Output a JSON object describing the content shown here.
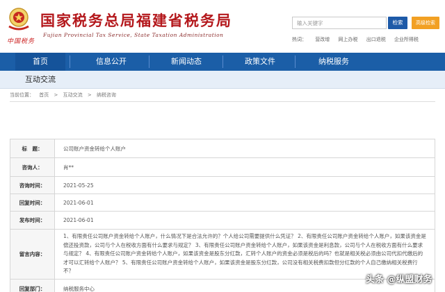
{
  "header": {
    "site_title": "国家税务总局福建省税务局",
    "site_subtitle": "Fujian Provincial Tax Service, State Taxation Administration",
    "logo_text": "中国税务",
    "search_placeholder": "输入关键字",
    "search_button": "检索",
    "advanced_button": "高级检索",
    "hot_searches": [
      "热词：",
      "营改增",
      "网上办税",
      "出口退税",
      "企业所得税"
    ]
  },
  "nav": {
    "items": [
      {
        "label": "首页"
      },
      {
        "label": "信息公开"
      },
      {
        "label": "新闻动态"
      },
      {
        "label": "政策文件"
      },
      {
        "label": "纳税服务"
      }
    ],
    "subnav_label": "互动交流"
  },
  "breadcrumb": [
    "当前位置：",
    "首页",
    ">",
    "互动交流",
    ">",
    "纳税咨询"
  ],
  "detail": {
    "rows": [
      {
        "key": "标　题：",
        "value": "公司账户资金转给个人账户"
      },
      {
        "key": "咨询人：",
        "value": "肖**"
      },
      {
        "key": "咨询时间：",
        "value": "2021-05-25"
      },
      {
        "key": "回复时间：",
        "value": "2021-06-01"
      },
      {
        "key": "发布时间：",
        "value": "2021-06-01"
      },
      {
        "key": "留言内容：",
        "value": "1、有限责任公司账户资金转给个人账户，什么情况下是合法允许的？个人给公司需要提供什么凭证？ 2、有限责任公司账户资金转给个人账户，如果该资金是偿还投资款，公司与个人在税收方面有什么要求与规定？ 3、有限责任公司账户资金转给个人账户，如果该资金是利息款，公司与个人在税收方面有什么要求与规定？ 4、有限责任公司账户资金转给个人账户，如果该资金是股东分红款，汇转个人账户的资金必须是税后的吗？也就是相关税必须由公司代扣代缴后的才可以汇转给个人账户？ 5、有限责任公司账户资金转给个人账户，如果该资金是股东分红款，公司没有相关税费扣款但分红款的个人自己缴纳相关税费行不？"
      },
      {
        "key": "回复部门：",
        "value": "纳税服务中心"
      }
    ]
  },
  "watermark": "头条 @纵盟财务",
  "colors": {
    "brand_red": "#b4181c",
    "nav_blue": "#1b5ea7",
    "search_blue": "#1d5aa8",
    "orange": "#f2a023"
  }
}
